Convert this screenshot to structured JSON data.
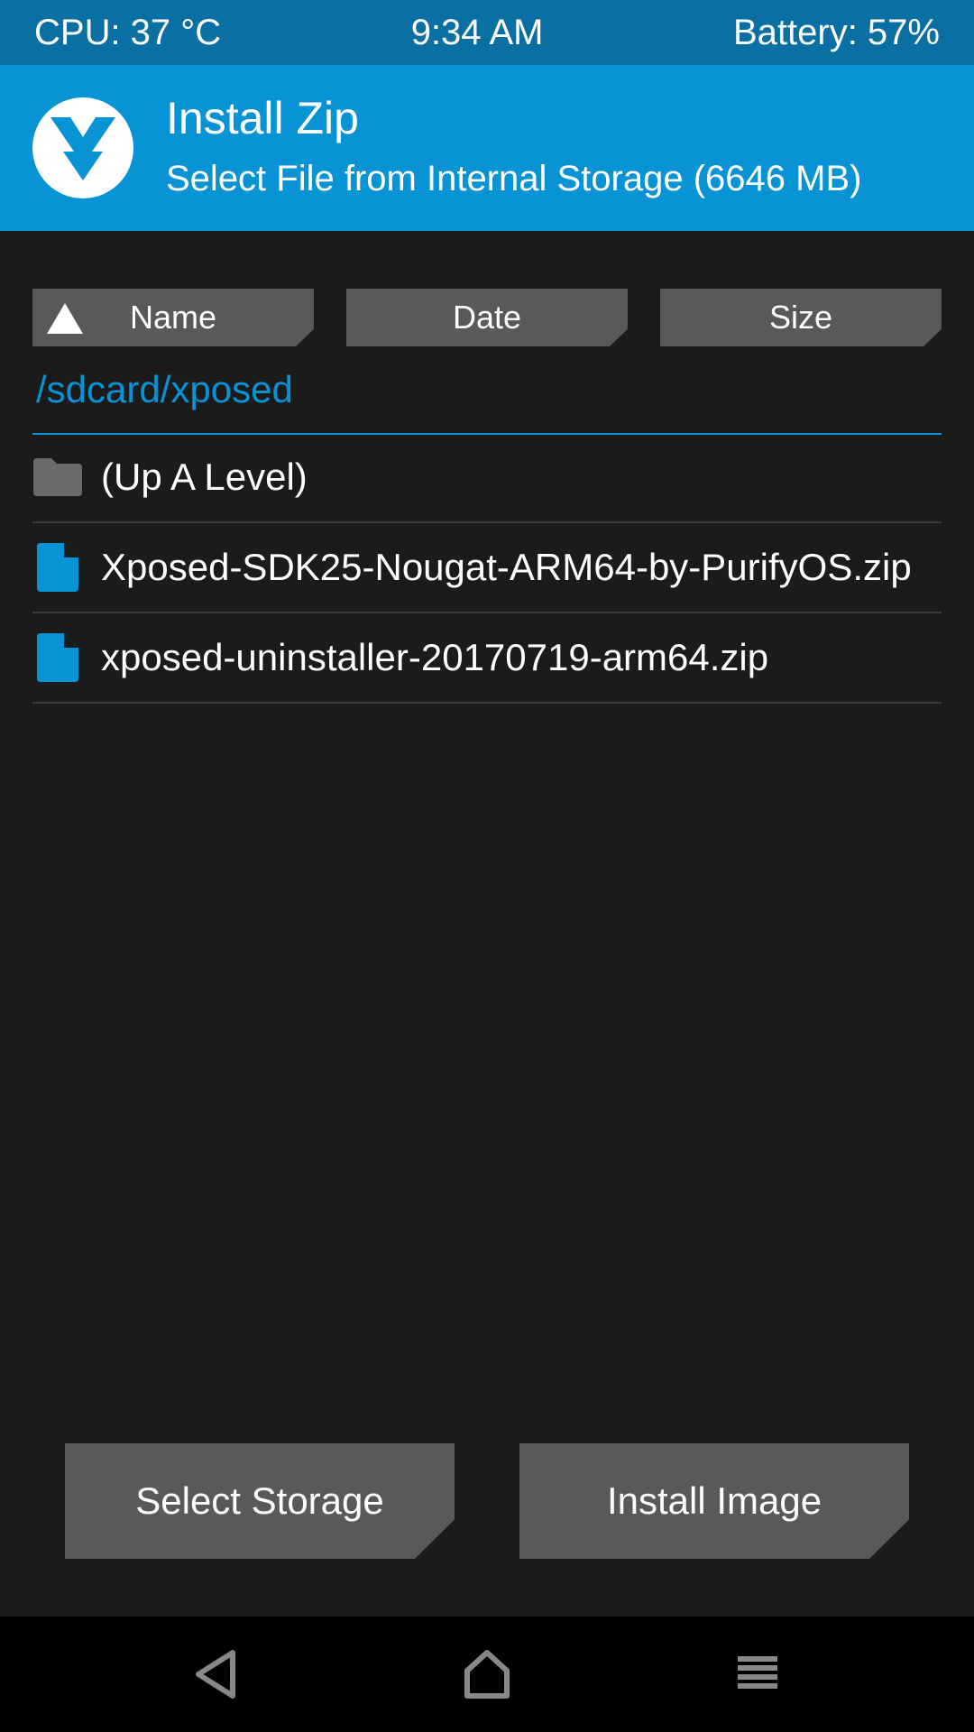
{
  "status_bar": {
    "cpu": "CPU: 37 °C",
    "time": "9:34 AM",
    "battery": "Battery: 57%"
  },
  "header": {
    "title": "Install Zip",
    "subtitle": "Select File from Internal Storage (6646 MB)",
    "logo_icon": "twrp-logo-icon"
  },
  "sort_buttons": [
    {
      "label": "Name",
      "active_icon": "sort-ascending-icon"
    },
    {
      "label": "Date"
    },
    {
      "label": "Size"
    }
  ],
  "current_path": "/sdcard/xposed",
  "file_list": [
    {
      "label": "(Up A Level)",
      "icon": "folder-icon"
    },
    {
      "label": "Xposed-SDK25-Nougat-ARM64-by-PurifyOS.zip",
      "icon": "file-icon"
    },
    {
      "label": "xposed-uninstaller-20170719-arm64.zip",
      "icon": "file-icon"
    }
  ],
  "actions": {
    "select_storage": "Select Storage",
    "install_image": "Install Image"
  },
  "nav": {
    "back_icon": "back-icon",
    "home_icon": "home-icon",
    "menu_icon": "menu-icon"
  },
  "colors": {
    "status_bg": "#0a6fa3",
    "header_bg": "#0793d4",
    "accent": "#0793d4",
    "background": "#1b1b1b",
    "button_bg": "#595959",
    "folder_icon": "#6a6a6a",
    "file_icon": "#0793d4"
  }
}
